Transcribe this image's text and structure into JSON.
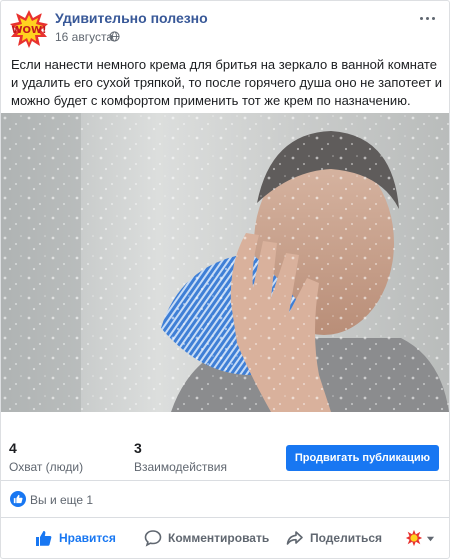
{
  "post": {
    "page_name": "Удивительно полезно",
    "date": "16 августа",
    "avatar_text": "WOW!",
    "text": "Если нанести немного крема для бритья на зеркало в ванной комнате и удалить его сухой тряпкой, то после горячего душа оно не запотеет и можно будет с комфортом применить тот же крем по назначению."
  },
  "stats": {
    "reach_value": "4",
    "reach_label": "Охват (люди)",
    "engagement_value": "3",
    "engagement_label": "Взаимодействия",
    "boost_label": "Продвигать публикацию"
  },
  "reactions": {
    "text": "Вы и еще 1"
  },
  "actions": {
    "like": "Нравится",
    "comment": "Комментировать",
    "share": "Поделиться"
  },
  "icons": [
    "wow-logo-icon",
    "globe-icon",
    "more-icon",
    "like-reaction-icon",
    "thumbs-up-icon",
    "comment-icon",
    "share-icon",
    "audience-avatar-icon",
    "caret-down-icon"
  ],
  "colors": {
    "link": "#385898",
    "accent": "#1877f2",
    "muted": "#606770",
    "text": "#1c1e21",
    "divider": "#dadde1"
  }
}
